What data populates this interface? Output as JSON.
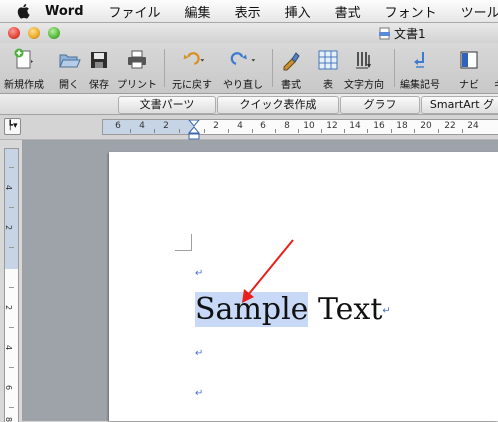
{
  "menubar": {
    "app": "Word",
    "items": [
      "ファイル",
      "編集",
      "表示",
      "挿入",
      "書式",
      "フォント",
      "ツール"
    ]
  },
  "window": {
    "title": "文書1"
  },
  "toolbar": {
    "new": "新規作成",
    "open": "開く",
    "save": "保存",
    "print": "プリント",
    "undo": "元に戻す",
    "redo": "やり直し",
    "format": "書式",
    "table": "表",
    "text_direction": "文字方向",
    "edit_marks": "編集記号",
    "navi": "ナビ",
    "cutoff": "ギ"
  },
  "gallery": {
    "tabs": [
      "文書パーツ",
      "クイック表作成",
      "グラフ",
      "SmartArt グ"
    ]
  },
  "ruler": {
    "h_numbers": [
      "6",
      "4",
      "2",
      "2",
      "4",
      "6",
      "8",
      "10",
      "12",
      "14",
      "16",
      "18",
      "20",
      "22",
      "24"
    ],
    "v_numbers": [
      "4",
      "2",
      "2",
      "4",
      "6",
      "8"
    ]
  },
  "document": {
    "selected": "Sample",
    "rest": " Text",
    "para_mark": "↵"
  },
  "colors": {
    "selection": "#c7d9f7",
    "annotation_arrow": "#e8201c",
    "para_mark": "#4a6fd0"
  }
}
